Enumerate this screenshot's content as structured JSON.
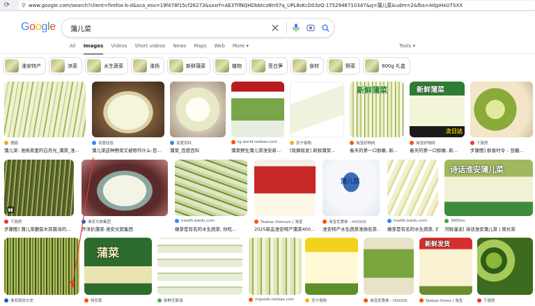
{
  "browser": {
    "url": "www.google.com/search?client=firefox-b-d&sca_esv=19f478f15cf26273&sxsrf=AE3TifNQHDbbtcz8tr07q_UPL8sKcD03zQ:1752946710347&q=蒲儿菜&udm=2&fbs=AIIjpHxU7SXX"
  },
  "google": {
    "logo": [
      "G",
      "o",
      "o",
      "g",
      "l",
      "e"
    ],
    "query": "蒲儿菜",
    "tabs": [
      "All",
      "Images",
      "Videos",
      "Short videos",
      "News",
      "Maps",
      "Web",
      "More ▾"
    ],
    "active_tab": "Images",
    "tools": "Tools ▾"
  },
  "chips": [
    "淮安特产",
    "凉菜",
    "水生蔬菜",
    "淮扬",
    "新鲜蒲菜",
    "植物",
    "茭白笋",
    "食材",
    "野菜",
    "800g 礼盒"
  ],
  "row1": [
    {
      "source": "搜狐",
      "caption": "蒲儿菜: 淮扬菜里的白月光_蒲菜_淮..."
    },
    {
      "source": "百度经验",
      "caption": "蒲儿菜这种野菜又被称作什么-百..."
    },
    {
      "source": "百度百科",
      "caption": "蒲菜_百度百科"
    },
    {
      "source": "tg.world.taobao.com",
      "caption": "蒲菜野生蒲儿菜淮安新..."
    },
    {
      "source": "苏宁易购",
      "caption": "[现摘现发] 新鲜蒲菜..."
    },
    {
      "source": "淘宝好物网",
      "caption": "春天的第一口鲜嫩, 新..."
    },
    {
      "source": "淘宝好物网",
      "caption": "春天的第一口鲜嫩, 新..."
    },
    {
      "source": "下厨房",
      "caption": "步骤图] 鲜香时令 – 豆糖..."
    }
  ],
  "row2": [
    {
      "source": "下厨房",
      "caption": "步骤图] 蒲儿菜蘑菇木耳菌汤的..."
    },
    {
      "source": "淮安文旅集团",
      "caption": "开洋扒蒲菜-淮安文旅集团"
    },
    {
      "source": "health.baidu.com",
      "caption": "嫩芽是有名的水生蔬菜, 你吃..."
    },
    {
      "source": "Taobao Vietnam | 淘宝",
      "caption": "2025新品淮安特产蒲菜400..."
    },
    {
      "source": "淘宝优惠券 - HOOOS",
      "caption": "淮安特产水生蔬菜淮扬名菜..."
    },
    {
      "source": "health.baidu.com",
      "caption": "嫩芽是有名的水生蔬菜, 你吃..."
    },
    {
      "source": "360Doc",
      "caption": "河鲜漫谈] 诗话淮安蒲儿菜 | 周长荣"
    }
  ],
  "row3": [
    {
      "source": "淮安政协文史"
    },
    {
      "source": "特色菜"
    },
    {
      "source": "新鲜互联港"
    },
    {
      "source": "mgoods.taobao.com"
    },
    {
      "source": "苏宁易购"
    },
    {
      "source": "淘宝优惠券 - HOOOS"
    },
    {
      "source": "Taobao Korea | 淘宝"
    },
    {
      "source": "下厨房"
    }
  ],
  "overlays": {
    "fresh_puca": "新鲜蒲菜",
    "next_day": "次日达",
    "poem": "诗话淮安蒲儿菜",
    "bag_label": "蒲儿菜",
    "poster": "蒲菜",
    "shipping": "新鲜发货"
  }
}
